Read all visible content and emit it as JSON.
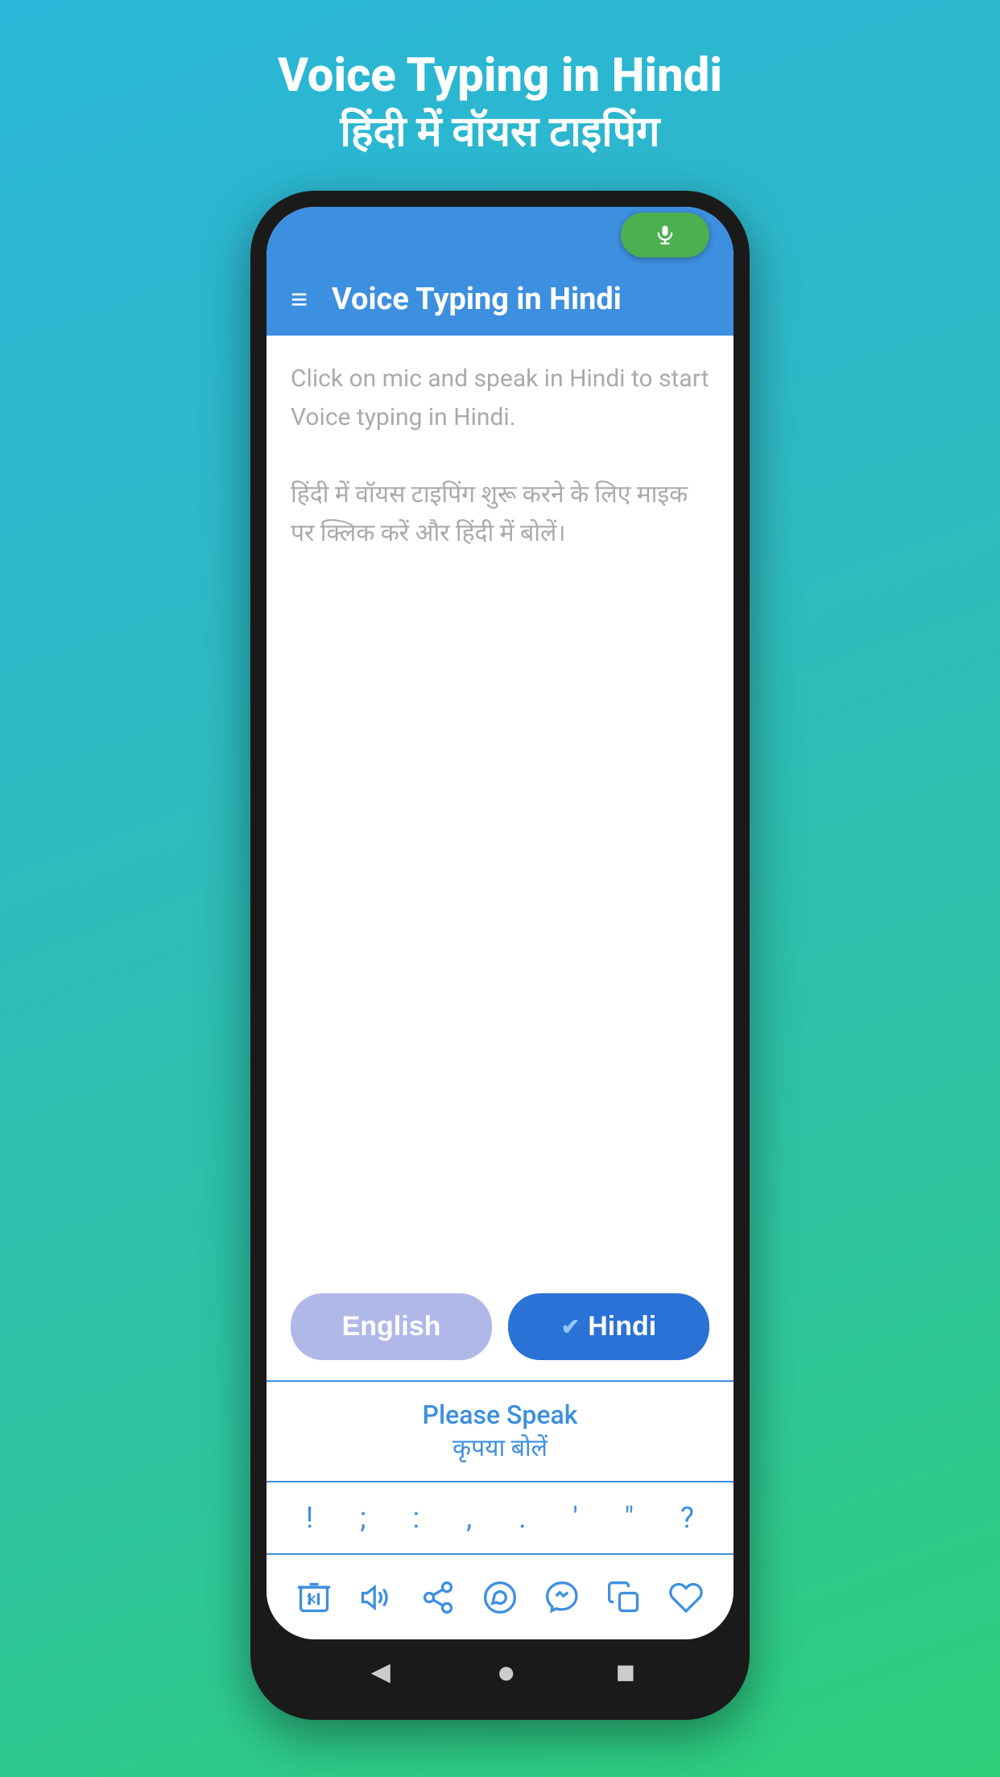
{
  "page": {
    "title_en": "Voice Typing in Hindi",
    "title_hi": "हिंदी में वॉयस टाइपिंग"
  },
  "app_bar": {
    "title": "Voice Typing in Hindi",
    "menu_icon": "≡"
  },
  "text_area": {
    "placeholder_line1": "Click on mic and speak in Hindi to start Voice typing in Hindi.",
    "placeholder_line2": "हिंदी में वॉयस टाइपिंग शुरू करने के लिए माइक पर क्लिक करें और हिंदी में बोलें।"
  },
  "language_buttons": {
    "english_label": "English",
    "hindi_label": "Hindi",
    "hindi_check": "✔"
  },
  "speak_prompt": {
    "en": "Please Speak",
    "hi": "कृपया बोलें"
  },
  "punctuation": {
    "keys": [
      "!",
      ";",
      ":",
      ",",
      ".",
      "'",
      "\"",
      "?"
    ]
  },
  "action_bar": {
    "icons": [
      {
        "name": "delete-icon",
        "symbol": "🗑"
      },
      {
        "name": "volume-icon",
        "symbol": "🔊"
      },
      {
        "name": "share-icon",
        "symbol": "↗"
      },
      {
        "name": "whatsapp-icon",
        "symbol": "💬"
      },
      {
        "name": "messenger-icon",
        "symbol": "💬"
      },
      {
        "name": "copy-icon",
        "symbol": "📋"
      },
      {
        "name": "heart-icon",
        "symbol": "♡"
      }
    ]
  },
  "nav_bar": {
    "back_icon": "◄",
    "home_icon": "●",
    "recents_icon": "■"
  },
  "colors": {
    "accent_blue": "#3d8fe0",
    "mic_green": "#4caf50",
    "lang_active": "#2a72d5",
    "lang_inactive": "#b0b8e8"
  }
}
